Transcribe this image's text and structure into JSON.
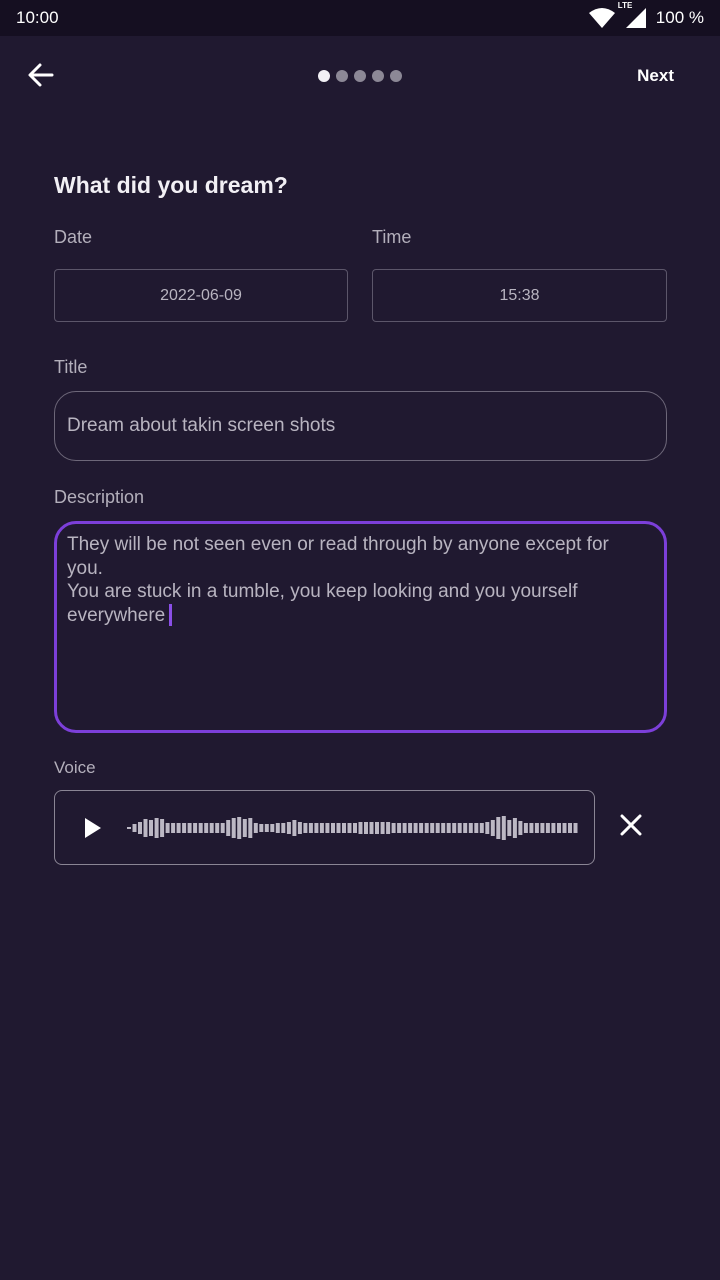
{
  "status_bar": {
    "time": "10:00",
    "network": "LTE",
    "battery": "100 %",
    "icons": [
      "wifi-icon",
      "cell-signal-icon"
    ]
  },
  "app_bar": {
    "back_icon": "arrow-back-icon",
    "next_label": "Next",
    "steps_total": 5,
    "step_current": 1
  },
  "form": {
    "heading": "What did you dream?",
    "date_label": "Date",
    "date_value": "2022-06-09",
    "time_label": "Time",
    "time_value": "15:38",
    "title_label": "Title",
    "title_value": "Dream about takin screen shots",
    "description_label": "Description",
    "description_lines": [
      "They will be not seen even or read through by anyone except for",
      "you.",
      "You are stuck in a tumble, you keep looking and you yourself",
      "everywhere"
    ],
    "voice_label": "Voice"
  },
  "voice": {
    "play_icon": "play-icon",
    "remove_icon": "close-icon"
  },
  "colors": {
    "background": "#201930",
    "status_bar": "#150f21",
    "accent": "#7c3fd9"
  }
}
